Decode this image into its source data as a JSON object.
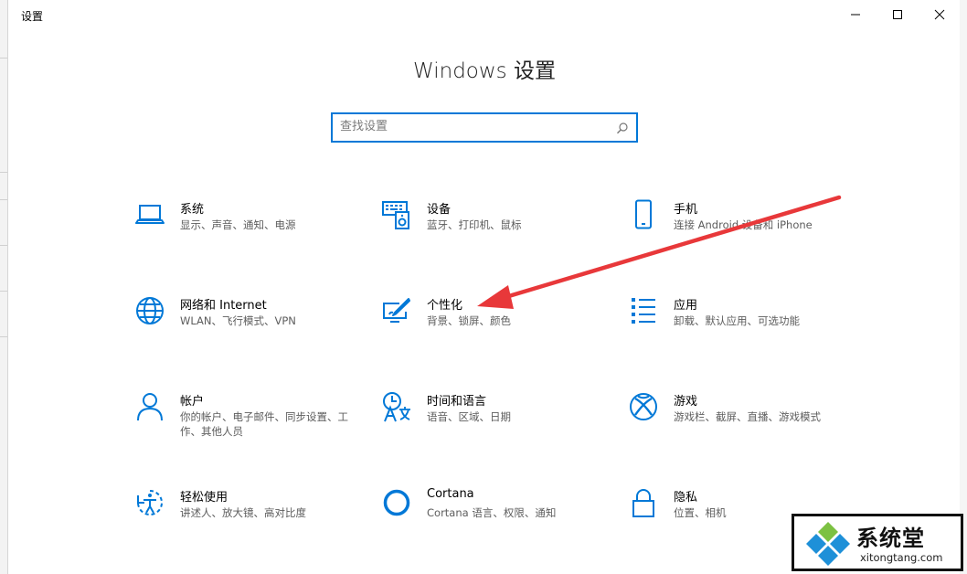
{
  "window": {
    "title": "设置",
    "minimize": "minimize",
    "maximize": "maximize",
    "close": "close"
  },
  "heading": "Windows 设置",
  "search": {
    "placeholder": "查找设置"
  },
  "tiles": [
    {
      "name": "系统",
      "desc": "显示、声音、通知、电源",
      "icon": "laptop-icon"
    },
    {
      "name": "设备",
      "desc": "蓝牙、打印机、鼠标",
      "icon": "devices-icon"
    },
    {
      "name": "手机",
      "desc": "连接 Android 设备和 iPhone",
      "icon": "phone-icon"
    },
    {
      "name": "网络和 Internet",
      "desc": "WLAN、飞行模式、VPN",
      "icon": "globe-icon"
    },
    {
      "name": "个性化",
      "desc": "背景、锁屏、颜色",
      "icon": "personalization-icon"
    },
    {
      "name": "应用",
      "desc": "卸载、默认应用、可选功能",
      "icon": "apps-list-icon"
    },
    {
      "name": "帐户",
      "desc": "你的帐户、电子邮件、同步设置、工作、其他人员",
      "icon": "person-icon"
    },
    {
      "name": "时间和语言",
      "desc": "语音、区域、日期",
      "icon": "time-language-icon"
    },
    {
      "name": "游戏",
      "desc": "游戏栏、截屏、直播、游戏模式",
      "icon": "xbox-icon"
    },
    {
      "name": "轻松使用",
      "desc": "讲述人、放大镜、高对比度",
      "icon": "ease-of-access-icon"
    },
    {
      "name": "Cortana",
      "desc": "Cortana 语言、权限、通知",
      "icon": "cortana-icon"
    },
    {
      "name": "隐私",
      "desc": "位置、相机",
      "icon": "lock-icon"
    }
  ],
  "watermark": {
    "brand": "系统堂",
    "url": "xitongtang.com"
  },
  "colors": {
    "accent": "#0078d7",
    "arrow": "#e8383a"
  }
}
